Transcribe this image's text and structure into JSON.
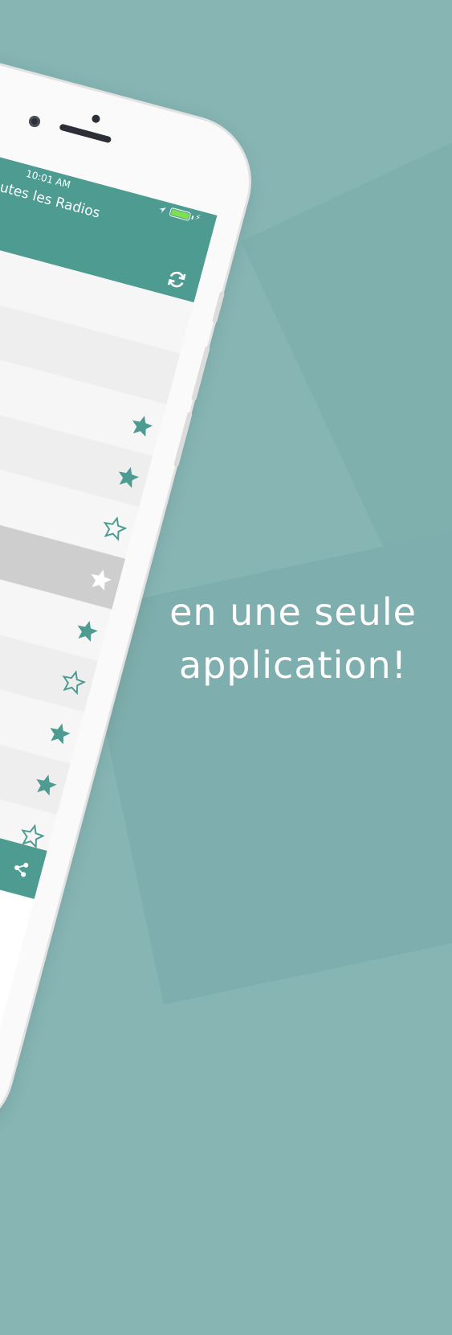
{
  "status_bar": {
    "time": "10:01 AM"
  },
  "header": {
    "title": "Toutes les Radios"
  },
  "colors": {
    "accent": "#4e9c91",
    "background": "#86b5b3",
    "selected_row": "#cecece"
  },
  "icons": {
    "refresh": "refresh-icon",
    "share": "share-icon",
    "location": "location-arrow-icon",
    "battery": "battery-icon"
  },
  "stations": [
    {
      "favorite": null,
      "state": "empty"
    },
    {
      "favorite": null,
      "state": "empty"
    },
    {
      "favorite": true,
      "state": "normal"
    },
    {
      "favorite": true,
      "state": "normal"
    },
    {
      "favorite": false,
      "state": "normal"
    },
    {
      "favorite": true,
      "state": "selected"
    },
    {
      "favorite": true,
      "state": "normal"
    },
    {
      "favorite": false,
      "state": "normal"
    },
    {
      "favorite": true,
      "state": "normal"
    },
    {
      "favorite": true,
      "state": "normal"
    },
    {
      "favorite": false,
      "state": "normal"
    }
  ],
  "tagline": {
    "line1": "en une seule",
    "line2": "application!"
  }
}
